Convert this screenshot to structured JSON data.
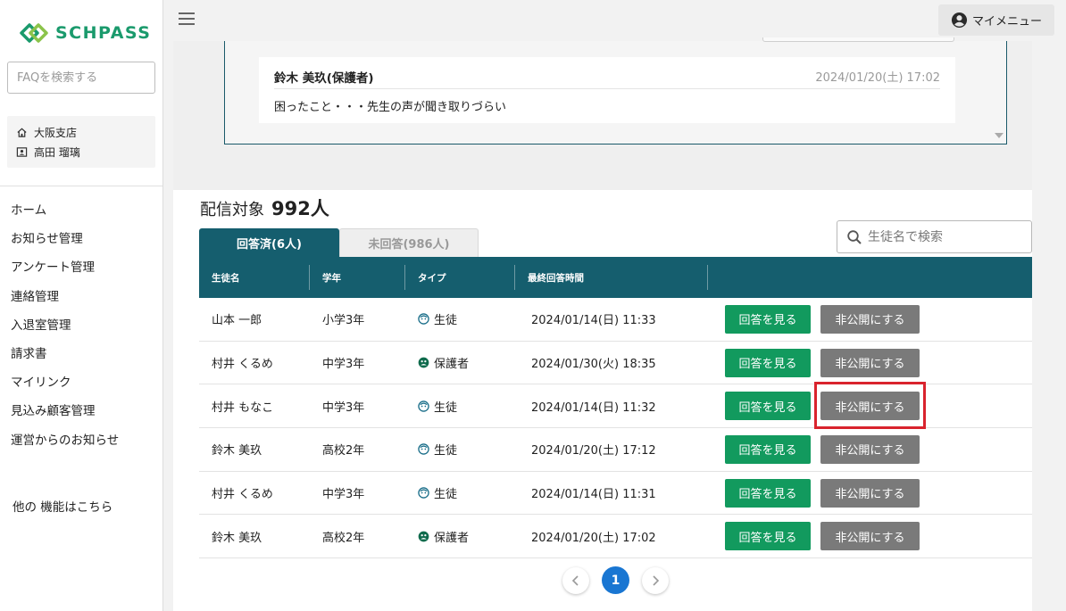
{
  "brand": {
    "name": "SCHPASS",
    "color": "#1a9a6c"
  },
  "sidebar": {
    "search_placeholder": "FAQを検索する",
    "branch": {
      "icon": "home-icon",
      "label": "大阪支店"
    },
    "user": {
      "icon": "id-card-icon",
      "label": "高田 瑠璃"
    },
    "nav_items": [
      {
        "label": "ホーム"
      },
      {
        "label": "お知らせ管理"
      },
      {
        "label": "アンケート管理"
      },
      {
        "label": "連絡管理"
      },
      {
        "label": "入退室管理"
      },
      {
        "label": "請求書"
      },
      {
        "label": "マイリンク"
      },
      {
        "label": "見込み顧客管理"
      },
      {
        "label": "運営からのお知らせ"
      }
    ],
    "other_features": "他の 機能はこちら"
  },
  "topbar": {
    "menu_icon": "hamburger-icon",
    "my_menu_label": "マイメニュー",
    "my_menu_icon": "account-circle-icon"
  },
  "message": {
    "author": "鈴木 美玖(保護者)",
    "datetime": "2024/01/20(土) 17:02",
    "body": "困ったこと・・・先生の声が聞き取りづらい"
  },
  "recipients": {
    "label": "配信対象",
    "count": "992人"
  },
  "tabs": [
    {
      "label": "回答済(6人)",
      "active": true
    },
    {
      "label": "未回答(986人)",
      "active": false
    }
  ],
  "student_search": {
    "placeholder": "生徒名で検索",
    "icon": "search-icon"
  },
  "table": {
    "headers": [
      "生徒名",
      "学年",
      "タイプ",
      "最終回答時間",
      ""
    ],
    "view_button": "回答を見る",
    "hide_button": "非公開にする",
    "rows": [
      {
        "name": "山本 一郎",
        "grade": "小学3年",
        "type": "生徒",
        "type_icon": "student-icon",
        "time": "2024/01/14(日) 11:33"
      },
      {
        "name": "村井 くるめ",
        "grade": "中学3年",
        "type": "保護者",
        "type_icon": "guardian-icon",
        "time": "2024/01/30(火) 18:35"
      },
      {
        "name": "村井 もなこ",
        "grade": "中学3年",
        "type": "生徒",
        "type_icon": "student-icon",
        "time": "2024/01/14(日) 11:32"
      },
      {
        "name": "鈴木 美玖",
        "grade": "高校2年",
        "type": "生徒",
        "type_icon": "student-icon",
        "time": "2024/01/20(土) 17:12"
      },
      {
        "name": "村井 くるめ",
        "grade": "中学3年",
        "type": "生徒",
        "type_icon": "student-icon",
        "time": "2024/01/14(日) 11:31"
      },
      {
        "name": "鈴木 美玖",
        "grade": "高校2年",
        "type": "保護者",
        "type_icon": "guardian-icon",
        "time": "2024/01/20(土) 17:02"
      }
    ]
  },
  "pagination": {
    "current": "1",
    "prev_icon": "chevron-left-icon",
    "next_icon": "chevron-right-icon"
  },
  "colors": {
    "header_teal": "#155e6e",
    "view_green": "#129a5e",
    "hide_gray": "#7a7a7a",
    "highlight_red": "#d9232d",
    "page_blue": "#1976d2"
  }
}
